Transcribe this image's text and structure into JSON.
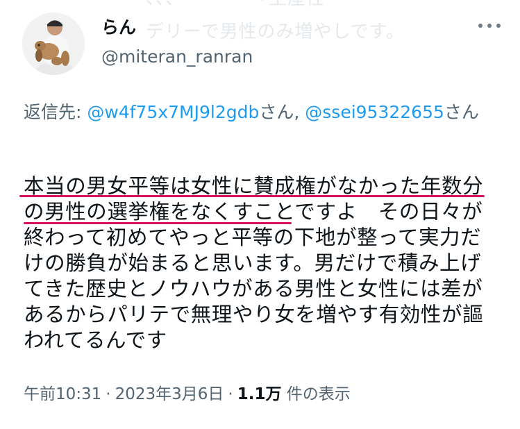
{
  "header": {
    "ghost_top": "、、、ーーー　「生産性",
    "ghost_mid": "デリーで男性のみ増やしです。"
  },
  "author": {
    "display_name": "らん",
    "handle": "@miteran_ranran",
    "avatar": "avatar-person-with-plush-dog"
  },
  "reply": {
    "prefix": "返信先: ",
    "mention_1": "@w4f75x7MJ9l2gdb",
    "sep": "さん, ",
    "mention_2": "@ssei95322655",
    "suffix": "さん"
  },
  "tweet": {
    "lines": [
      "本当の男女平等は女性に賛成権がなかった年数分",
      "の男性の選挙権をなくすことですよ　その日々が",
      "終わって初めてやっと平等の下地が整って実力だ",
      "けの勝負が始まると思います。男だけで積み上げ",
      "てきた歴史とノウハウがある男性と女性には差が",
      "あるからパリテで無理やり女を増やす有効性が謳",
      "われてるんです"
    ],
    "highlight_color": "#d6135e"
  },
  "meta": {
    "time": "午前10:31",
    "separator": "·",
    "date": "2023年3月6日",
    "views_count": "1.1万",
    "views_label": "件の表示"
  },
  "colors": {
    "text": "#0f1419",
    "secondary": "#536471",
    "link": "#1d9bf0"
  }
}
